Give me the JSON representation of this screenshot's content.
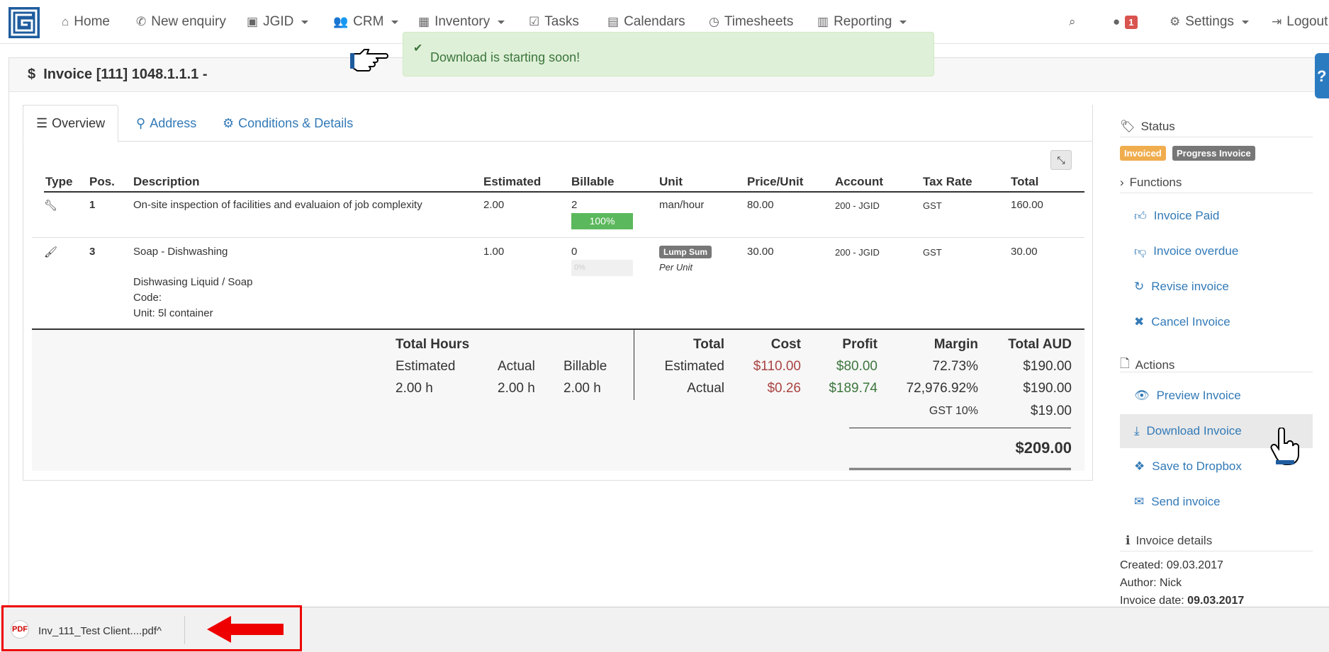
{
  "nav": {
    "home": "Home",
    "new_enquiry": "New enquiry",
    "jgid": "JGID",
    "crm": "CRM",
    "inventory": "Inventory",
    "tasks": "Tasks",
    "calendars": "Calendars",
    "timesheets": "Timesheets",
    "reporting": "Reporting",
    "notifications_count": "1",
    "settings": "Settings",
    "logout": "Logout"
  },
  "toast": {
    "message": "Download is starting soon!"
  },
  "panel": {
    "title": "Invoice [111] 1048.1.1.1 -",
    "help": "?"
  },
  "tabs": {
    "overview": "Overview",
    "address": "Address",
    "conditions": "Conditions & Details"
  },
  "table": {
    "headers": {
      "type": "Type",
      "pos": "Pos.",
      "description": "Description",
      "estimated": "Estimated",
      "billable": "Billable",
      "unit": "Unit",
      "price_unit": "Price/Unit",
      "account": "Account",
      "tax_rate": "Tax Rate",
      "total": "Total"
    },
    "rows": [
      {
        "icon": "wrench-icon",
        "pos": "1",
        "description": "On-site inspection of facilities and evaluaion of job complexity",
        "estimated": "2.00",
        "billable": "2",
        "billable_percent": "100%",
        "billable_fraction": 1.0,
        "unit": "man/hour",
        "price_unit": "80.00",
        "account": "200 - JGID",
        "tax_rate": "GST",
        "total": "160.00"
      },
      {
        "icon": "brush-icon",
        "pos": "3",
        "description": "Soap - Dishwashing",
        "details": [
          "Dishwasing Liquid / Soap",
          "Code:",
          "Unit: 5l container"
        ],
        "estimated": "1.00",
        "billable": "0",
        "billable_percent": "0%",
        "billable_fraction": 0.0,
        "unit_label": "Lump Sum",
        "unit_sub": "Per Unit",
        "price_unit": "30.00",
        "account": "200 - JGID",
        "tax_rate": "GST",
        "total": "30.00"
      }
    ]
  },
  "summary": {
    "total_hours": "Total Hours",
    "estimated_label": "Estimated",
    "actual_label": "Actual",
    "billable_label": "Billable",
    "hours_estimated": "2.00 h",
    "hours_actual": "2.00 h",
    "hours_billable": "2.00 h",
    "col_total": "Total",
    "col_cost": "Cost",
    "col_profit": "Profit",
    "col_margin": "Margin",
    "col_total_aud": "Total AUD",
    "row_estimated": {
      "label": "Estimated",
      "cost": "$110.00",
      "profit": "$80.00",
      "margin": "72.73%",
      "total": "$190.00"
    },
    "row_actual": {
      "label": "Actual",
      "cost": "$0.26",
      "profit": "$189.74",
      "margin": "72,976.92%",
      "total": "$190.00"
    },
    "gst_label": "GST 10%",
    "gst_value": "$19.00",
    "grand_total": "$209.00"
  },
  "sidebar": {
    "status_heading": "Status",
    "status_invoiced": "Invoiced",
    "status_progress": "Progress Invoice",
    "functions_heading": "Functions",
    "invoice_paid": "Invoice Paid",
    "invoice_overdue": "Invoice overdue",
    "revise_invoice": "Revise invoice",
    "cancel_invoice": "Cancel Invoice",
    "actions_heading": "Actions",
    "preview_invoice": "Preview Invoice",
    "download_invoice": "Download Invoice",
    "save_dropbox": "Save to Dropbox",
    "send_invoice": "Send invoice",
    "details_heading": "Invoice details",
    "created": "Created: 09.03.2017",
    "author": "Author: Nick",
    "invoice_date_label": "Invoice date: ",
    "invoice_date_value": "09.03.2017"
  },
  "download_bar": {
    "filename": "Inv_111_Test Client....pdf",
    "caret": "^"
  },
  "colors": {
    "brand": "#1f5c9e",
    "link": "#337ab7",
    "success": "#5cb85c",
    "warning": "#f0ad4e",
    "danger": "#d9534f"
  }
}
